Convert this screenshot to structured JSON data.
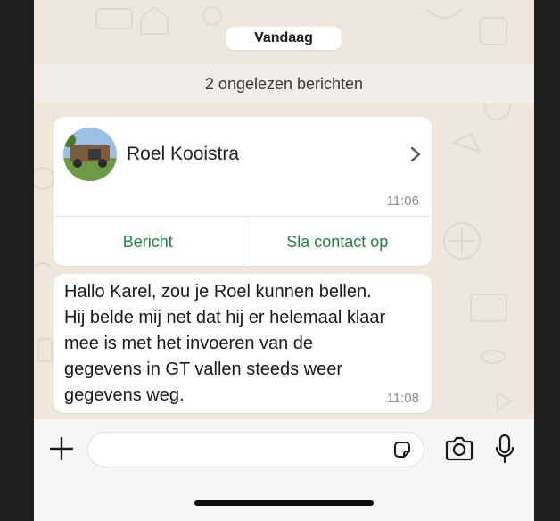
{
  "chat": {
    "date_label": "Vandaag",
    "unread_label": "2 ongelezen berichten"
  },
  "contact_card": {
    "name": "Roel Kooistra",
    "time": "11:06",
    "message_button": "Bericht",
    "save_contact_button": "Sla contact op"
  },
  "message": {
    "lines": [
      "Hallo Karel, zou je Roel kunnen bellen.",
      "Hij belde mij net dat hij er helemaal klaar",
      "mee is met het invoeren van de",
      "gegevens in GT vallen steeds weer",
      "gegevens weg."
    ],
    "time": "11:08"
  },
  "composer": {
    "placeholder": ""
  },
  "icons": {
    "add": "plus-icon",
    "sticker": "sticker-icon",
    "camera": "camera-icon",
    "mic": "microphone-icon",
    "chevron": "chevron-right-icon"
  },
  "colors": {
    "chat_background": "#efe7dc",
    "action_green": "#2a7d45",
    "bubble": "#ffffff"
  }
}
